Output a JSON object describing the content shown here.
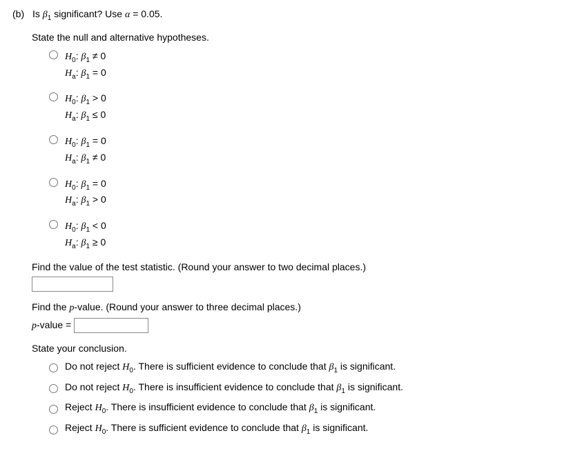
{
  "header": {
    "part": "(b)",
    "question": "Is β₁ significant? Use α = 0.05."
  },
  "hyp": {
    "prompt": "State the null and alternative hypotheses.",
    "options": [
      {
        "h0": "H₀: β₁ ≠ 0",
        "ha": "Hₐ: β₁ = 0"
      },
      {
        "h0": "H₀: β₁ > 0",
        "ha": "Hₐ: β₁ ≤ 0"
      },
      {
        "h0": "H₀: β₁ = 0",
        "ha": "Hₐ: β₁ ≠ 0"
      },
      {
        "h0": "H₀: β₁ = 0",
        "ha": "Hₐ: β₁ > 0"
      },
      {
        "h0": "H₀: β₁ < 0",
        "ha": "Hₐ: β₁ ≥ 0"
      }
    ]
  },
  "tstat": {
    "prompt": "Find the value of the test statistic. (Round your answer to two decimal places.)"
  },
  "pval": {
    "prompt": "Find the p-value. (Round your answer to three decimal places.)",
    "label": "p-value ="
  },
  "concl": {
    "prompt": "State your conclusion.",
    "options": [
      "Do not reject H₀. There is sufficient evidence to conclude that β₁ is significant.",
      "Do not reject H₀. There is insufficient evidence to conclude that β₁ is significant.",
      "Reject H₀. There is insufficient evidence to conclude that β₁ is significant.",
      "Reject H₀. There is sufficient evidence to conclude that β₁ is significant."
    ]
  }
}
